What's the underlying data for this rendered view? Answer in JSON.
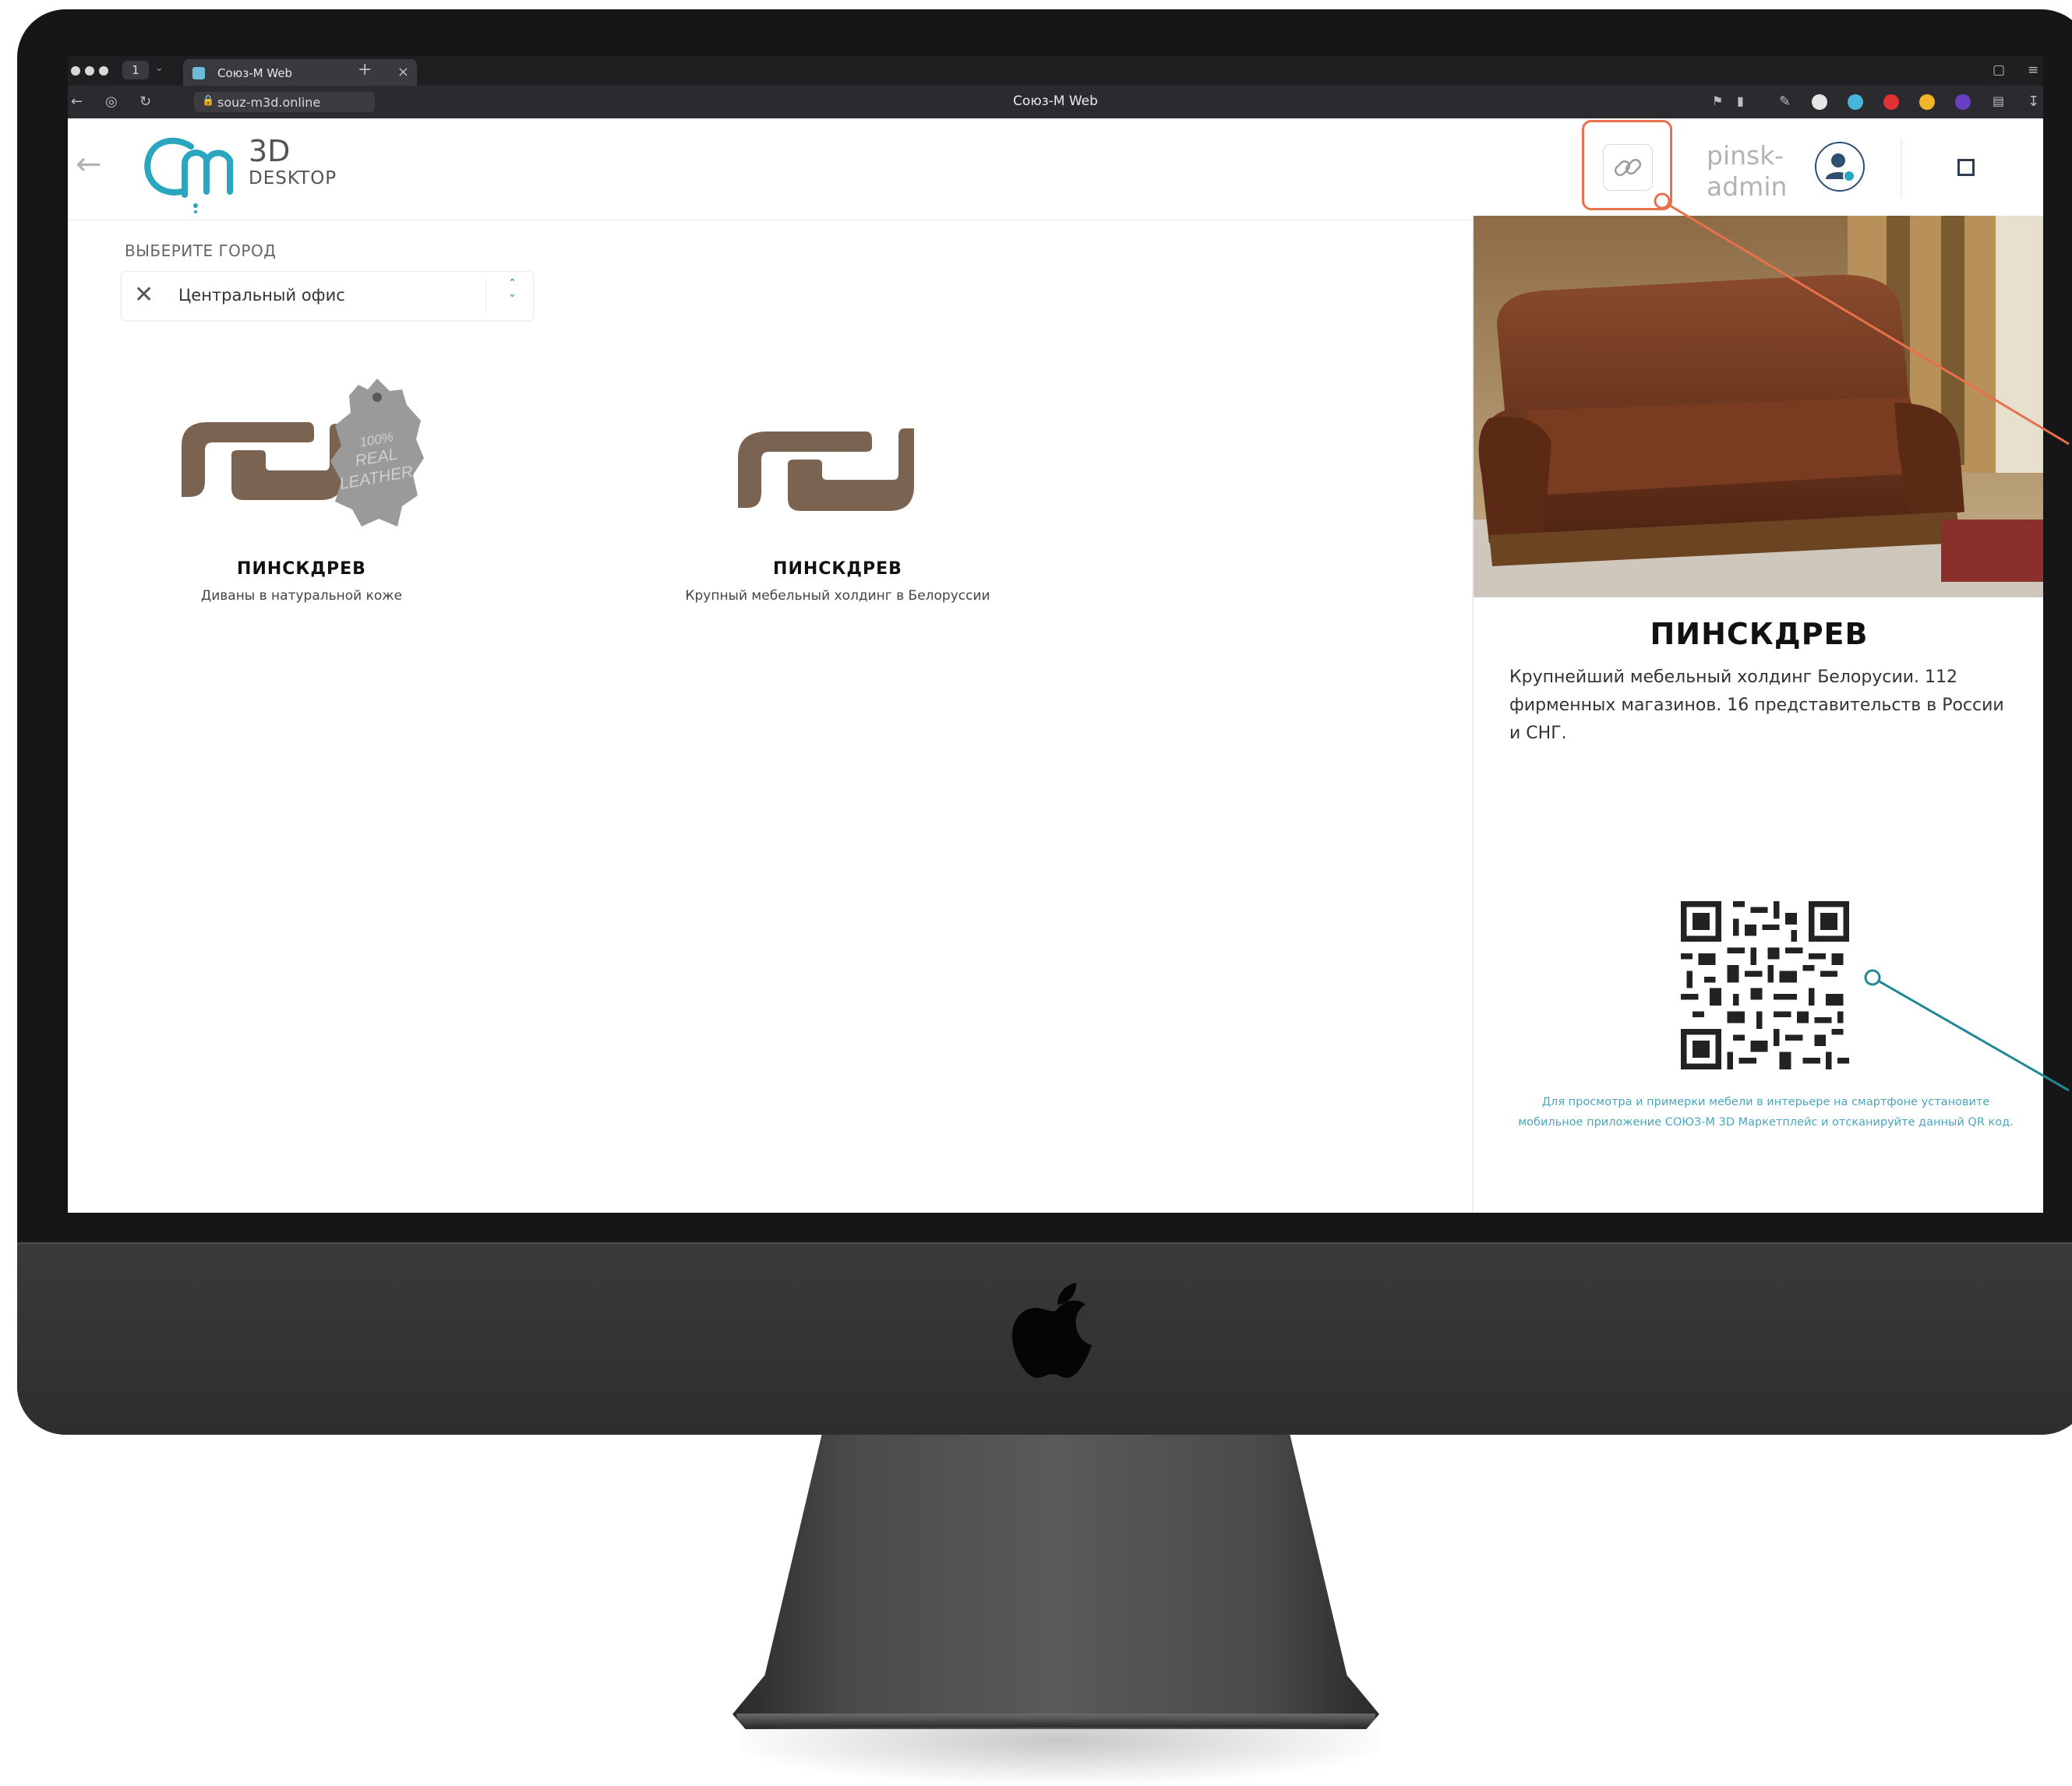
{
  "browser": {
    "tab_count": "1",
    "tab_title": "Союз-М Web",
    "url": "souz-m3d.online",
    "page_title": "Союз-М Web"
  },
  "app": {
    "logo_3d": "3D",
    "logo_desktop": "DESKTOP",
    "user": {
      "line1": "pinsk-",
      "line2": "admin"
    }
  },
  "city": {
    "label": "ВЫБЕРИТЕ ГОРОД",
    "value": "Центральный офис"
  },
  "brands": [
    {
      "name": "ПИНСКДРЕВ",
      "description": "Диваны в натуральной коже",
      "badge": [
        "100%",
        "REAL",
        "LEATHER"
      ]
    },
    {
      "name": "ПИНСКДРЕВ",
      "description": "Крупный мебельный холдинг в Белоруссии"
    }
  ],
  "details": {
    "title": "ПИНСКДРЕВ",
    "description": "Крупнейший мебельный холдинг Белорусии. 112 фирменных магазинов. 16 представительств в России и СНГ.",
    "qr_hint": "Для просмотра и примерки мебели в интерьере на смартфоне установите мобильное приложение СОЮЗ-М 3D Маркетплейс и отсканируйте данный QR код."
  },
  "colors": {
    "accent_teal": "#2aa6c1",
    "brand_brown": "#7a6351",
    "highlight_orange": "#e8704a",
    "annotation_teal": "#1f8a96"
  }
}
